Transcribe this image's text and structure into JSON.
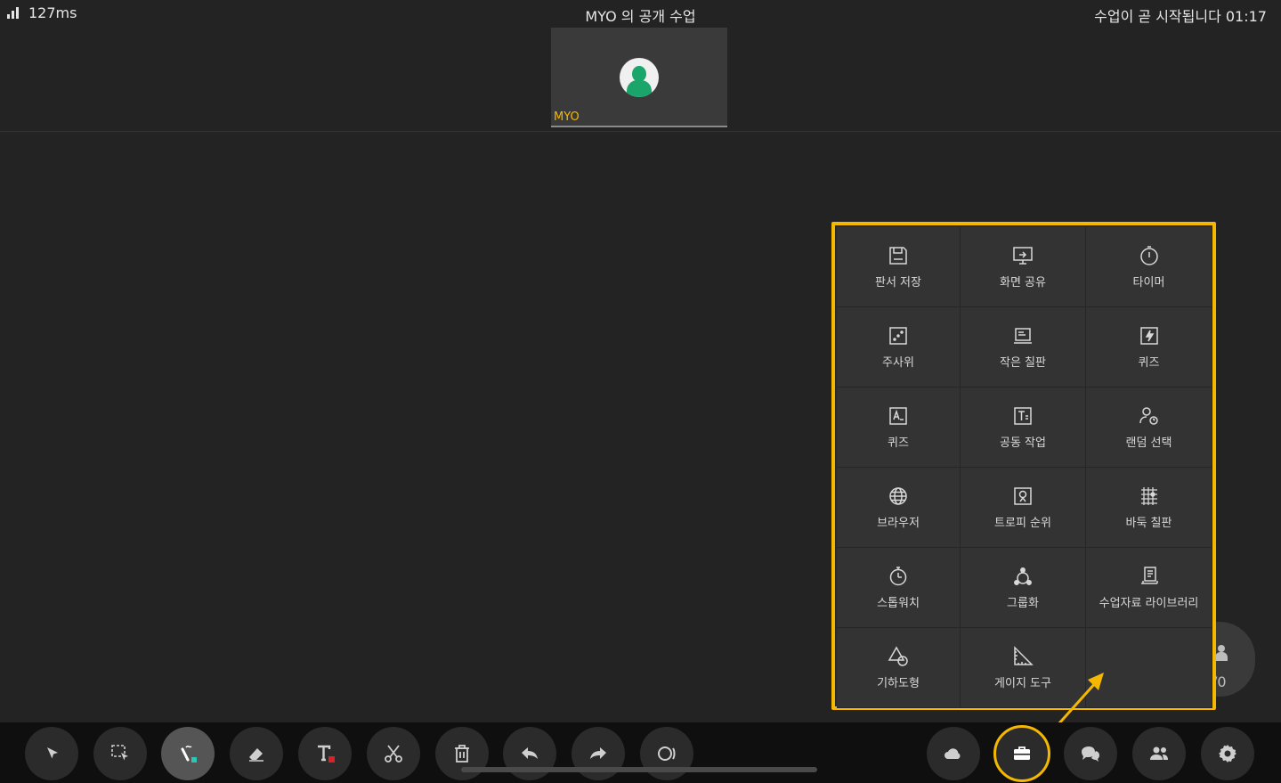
{
  "status": {
    "latency": "127ms",
    "class_title": "MYO 의 공개 수업",
    "class_status": "수업이 곧 시작됩니다 01:17"
  },
  "video_tile": {
    "name": "MYO"
  },
  "participants_float": {
    "count": "/0"
  },
  "tools_panel": {
    "items": [
      {
        "label": "판서 저장",
        "icon": "save-icon"
      },
      {
        "label": "화면 공유",
        "icon": "screen-share-icon"
      },
      {
        "label": "타이머",
        "icon": "timer-icon"
      },
      {
        "label": "주사위",
        "icon": "dice-icon"
      },
      {
        "label": "작은 칠판",
        "icon": "small-blackboard-icon"
      },
      {
        "label": "퀴즈",
        "icon": "quiz-flash-icon"
      },
      {
        "label": "퀴즈",
        "icon": "quiz-text-icon"
      },
      {
        "label": "공동 작업",
        "icon": "collaboration-icon"
      },
      {
        "label": "랜덤 선택",
        "icon": "random-pick-icon"
      },
      {
        "label": "브라우저",
        "icon": "globe-icon"
      },
      {
        "label": "트로피 순위",
        "icon": "trophy-icon"
      },
      {
        "label": "바둑 칠판",
        "icon": "go-board-icon"
      },
      {
        "label": "스톱워치",
        "icon": "stopwatch-icon"
      },
      {
        "label": "그룹화",
        "icon": "group-icon"
      },
      {
        "label": "수업자료 라이브러리",
        "icon": "library-icon"
      },
      {
        "label": "기하도형",
        "icon": "geometry-icon"
      },
      {
        "label": "게이지 도구",
        "icon": "ruler-icon"
      }
    ]
  },
  "toolbar": {
    "buttons": [
      {
        "icon": "pointer-icon"
      },
      {
        "icon": "area-select-icon"
      },
      {
        "icon": "pen-icon"
      },
      {
        "icon": "eraser-icon"
      },
      {
        "icon": "text-icon"
      },
      {
        "icon": "scissors-icon"
      },
      {
        "icon": "trash-icon"
      },
      {
        "icon": "undo-icon"
      },
      {
        "icon": "redo-icon"
      },
      {
        "icon": "laser-icon"
      },
      {
        "icon": "cloud-icon"
      },
      {
        "icon": "toolbox-icon"
      },
      {
        "icon": "chat-icon"
      },
      {
        "icon": "users-icon"
      },
      {
        "icon": "gear-icon"
      }
    ]
  },
  "colors": {
    "accent": "#f5b800",
    "avatar": "#1aa56a",
    "pen_dot": "#2ec4b6",
    "text_dot": "#e02020"
  }
}
